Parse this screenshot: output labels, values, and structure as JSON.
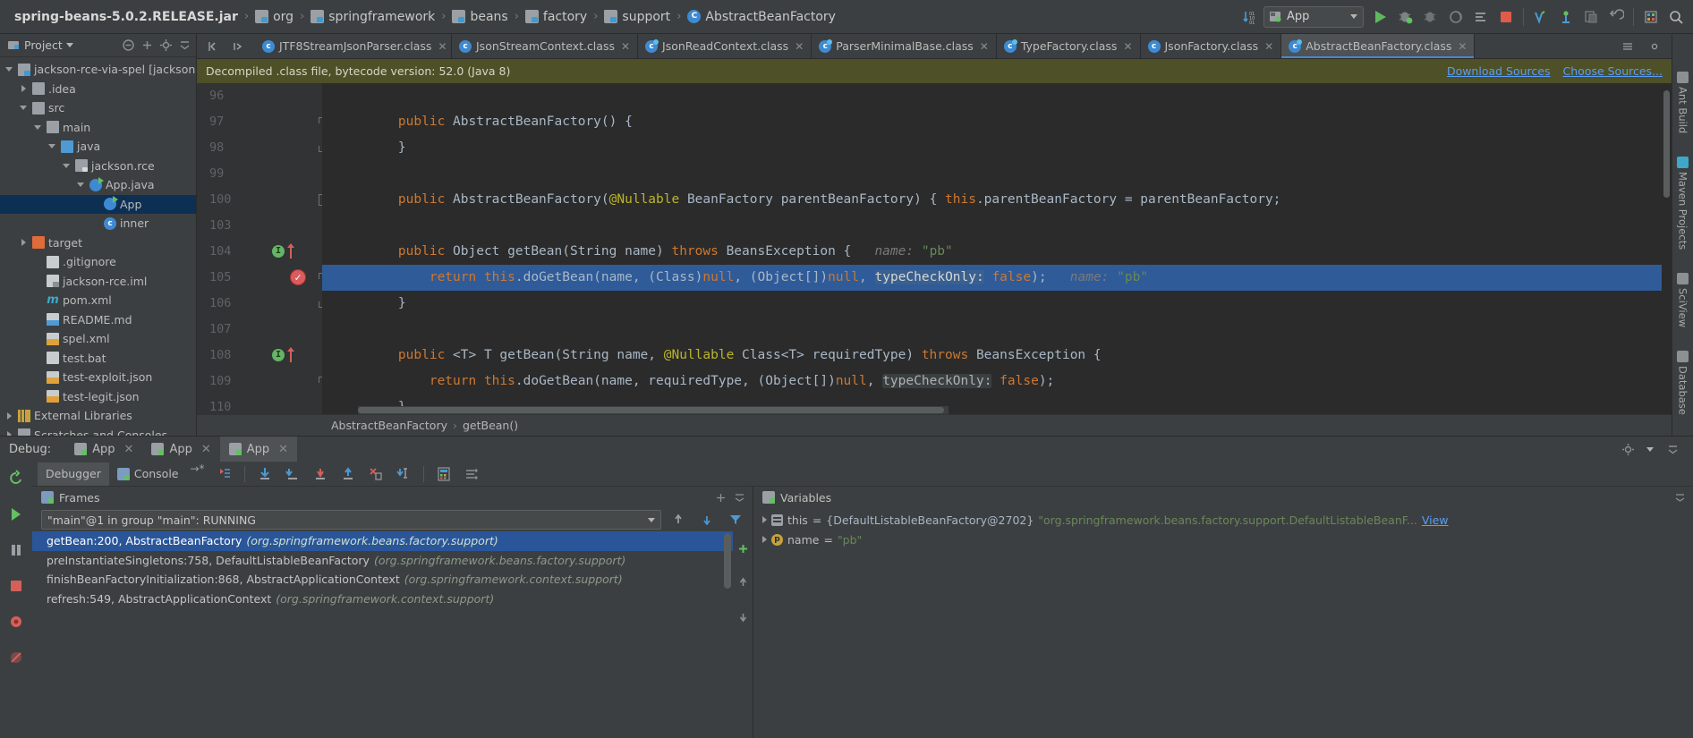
{
  "window": {
    "breadcrumbs": [
      {
        "label": "spring-beans-5.0.2.RELEASE.jar",
        "icon": "jar-icon",
        "root": true
      },
      {
        "label": "org",
        "icon": "folder-icon"
      },
      {
        "label": "springframework",
        "icon": "folder-icon"
      },
      {
        "label": "beans",
        "icon": "folder-icon"
      },
      {
        "label": "factory",
        "icon": "folder-icon"
      },
      {
        "label": "support",
        "icon": "folder-icon"
      },
      {
        "label": "AbstractBeanFactory",
        "icon": "class-icon"
      }
    ],
    "run_config": {
      "label": "App",
      "icon": "run-config-icon"
    },
    "toolbar_icons": [
      "sort-alphabetically-icon",
      "run-icon",
      "debug-icon",
      "coverage-icon",
      "profile-icon",
      "attach-icon",
      "stop-icon",
      "checkin-icon",
      "update-project-icon",
      "compare-icon",
      "revert-icon",
      "settings-icon",
      "search-icon"
    ]
  },
  "project": {
    "title": "Project",
    "header_icons": [
      "collapse-all-icon",
      "expand-icon",
      "settings-icon",
      "hide-icon"
    ],
    "tree": [
      {
        "label": "jackson-rce-via-spel [jackson",
        "indent": 0,
        "twisty": "down",
        "icon": "module-folder",
        "selected": false
      },
      {
        "label": ".idea",
        "indent": 1,
        "twisty": "right",
        "icon": "folder-plain",
        "selected": false
      },
      {
        "label": "src",
        "indent": 1,
        "twisty": "down",
        "icon": "folder-plain",
        "selected": false
      },
      {
        "label": "main",
        "indent": 2,
        "twisty": "down",
        "icon": "folder-plain",
        "selected": false
      },
      {
        "label": "java",
        "indent": 3,
        "twisty": "down",
        "icon": "folder-src",
        "selected": false
      },
      {
        "label": "jackson.rce",
        "indent": 4,
        "twisty": "down",
        "icon": "folder-pkg",
        "selected": false
      },
      {
        "label": "App.java",
        "indent": 5,
        "twisty": "down",
        "icon": "java-main",
        "selected": false
      },
      {
        "label": "App",
        "indent": 6,
        "twisty": "none",
        "icon": "java-main",
        "selected": true
      },
      {
        "label": "inner",
        "indent": 6,
        "twisty": "none",
        "icon": "java-class",
        "selected": false
      },
      {
        "label": "target",
        "indent": 1,
        "twisty": "right",
        "icon": "folder-target",
        "selected": false
      },
      {
        "label": ".gitignore",
        "indent": 2,
        "twisty": "none",
        "icon": "file",
        "selected": false
      },
      {
        "label": "jackson-rce.iml",
        "indent": 2,
        "twisty": "none",
        "icon": "file-module",
        "selected": false
      },
      {
        "label": "pom.xml",
        "indent": 2,
        "twisty": "none",
        "icon": "maven",
        "selected": false
      },
      {
        "label": "README.md",
        "indent": 2,
        "twisty": "none",
        "icon": "file-md",
        "selected": false
      },
      {
        "label": "spel.xml",
        "indent": 2,
        "twisty": "none",
        "icon": "file-xml-spring",
        "selected": false
      },
      {
        "label": "test.bat",
        "indent": 2,
        "twisty": "none",
        "icon": "file",
        "selected": false
      },
      {
        "label": "test-exploit.json",
        "indent": 2,
        "twisty": "none",
        "icon": "file-json",
        "selected": false
      },
      {
        "label": "test-legit.json",
        "indent": 2,
        "twisty": "none",
        "icon": "file-json",
        "selected": false
      },
      {
        "label": "External Libraries",
        "indent": 0,
        "twisty": "right",
        "icon": "library",
        "selected": false
      },
      {
        "label": "Scratches and Consoles",
        "indent": 0,
        "twisty": "right",
        "icon": "scratches",
        "selected": false
      }
    ]
  },
  "editor": {
    "tabs": [
      {
        "label": "JTF8StreamJsonParser.class",
        "active": false,
        "icon": "class-icon"
      },
      {
        "label": "JsonStreamContext.class",
        "active": false,
        "icon": "class-icon"
      },
      {
        "label": "JsonReadContext.class",
        "active": false,
        "icon": "class-icon-deco"
      },
      {
        "label": "ParserMinimalBase.class",
        "active": false,
        "icon": "class-icon-deco"
      },
      {
        "label": "TypeFactory.class",
        "active": false,
        "icon": "class-icon-deco"
      },
      {
        "label": "JsonFactory.class",
        "active": false,
        "icon": "class-icon"
      },
      {
        "label": "AbstractBeanFactory.class",
        "active": true,
        "icon": "class-icon-deco"
      }
    ],
    "notification": {
      "text": "Decompiled .class file, bytecode version: 52.0 (Java 8)",
      "links": [
        "Download Sources",
        "Choose Sources..."
      ]
    },
    "breadcrumb": [
      "AbstractBeanFactory",
      "getBean()"
    ],
    "lines": [
      {
        "num": "96",
        "segments": []
      },
      {
        "num": "97",
        "segments": [
          {
            "t": "    ",
            "c": "txt"
          },
          {
            "t": "public ",
            "c": "kw"
          },
          {
            "t": "AbstractBeanFactory() {",
            "c": "txt"
          }
        ]
      },
      {
        "num": "98",
        "segments": [
          {
            "t": "    }",
            "c": "txt"
          }
        ]
      },
      {
        "num": "99",
        "segments": []
      },
      {
        "num": "100",
        "segments": [
          {
            "t": "    ",
            "c": "txt"
          },
          {
            "t": "public ",
            "c": "kw"
          },
          {
            "t": "AbstractBeanFactory(",
            "c": "txt"
          },
          {
            "t": "@Nullable",
            "c": "annot"
          },
          {
            "t": " BeanFactory parentBeanFactory) { ",
            "c": "txt"
          },
          {
            "t": "this",
            "c": "kw"
          },
          {
            "t": ".parentBeanFactory = parentBeanFactory;",
            "c": "txt"
          }
        ]
      },
      {
        "num": "103",
        "segments": []
      },
      {
        "num": "104",
        "segments": [
          {
            "t": "    ",
            "c": "txt"
          },
          {
            "t": "public ",
            "c": "kw"
          },
          {
            "t": "Object getBean(String name) ",
            "c": "txt"
          },
          {
            "t": "throws ",
            "c": "kw"
          },
          {
            "t": "BeansException {",
            "c": "txt"
          },
          {
            "t": "   name:",
            "c": "hint"
          },
          {
            "t": " \"pb\"",
            "c": "str"
          }
        ],
        "gutter": {
          "green": "I",
          "arrow": true
        }
      },
      {
        "num": "105",
        "highlight": true,
        "breakpoint": "done",
        "segments": [
          {
            "t": "        ",
            "c": "txt"
          },
          {
            "t": "return ",
            "c": "kw"
          },
          {
            "t": "this",
            "c": "kw"
          },
          {
            "t": ".doGetBean(name, (",
            "c": "txt"
          },
          {
            "t": "Class",
            "c": "txt"
          },
          {
            "t": ")",
            "c": "txt"
          },
          {
            "t": "null",
            "c": "kw"
          },
          {
            "t": ", (",
            "c": "txt"
          },
          {
            "t": "Object[]",
            "c": "txt"
          },
          {
            "t": ")",
            "c": "txt"
          },
          {
            "t": "null",
            "c": "kw"
          },
          {
            "t": ", ",
            "c": "txt"
          },
          {
            "t": "typeCheckOnly:",
            "c": "paramhl"
          },
          {
            "t": " ",
            "c": "txt"
          },
          {
            "t": "false",
            "c": "kw"
          },
          {
            "t": ");",
            "c": "txt"
          },
          {
            "t": "   name:",
            "c": "hint"
          },
          {
            "t": " \"pb\"",
            "c": "str"
          }
        ]
      },
      {
        "num": "106",
        "segments": [
          {
            "t": "    }",
            "c": "txt"
          }
        ]
      },
      {
        "num": "107",
        "segments": []
      },
      {
        "num": "108",
        "segments": [
          {
            "t": "    ",
            "c": "txt"
          },
          {
            "t": "public ",
            "c": "kw"
          },
          {
            "t": "<T> T getBean(String name, ",
            "c": "txt"
          },
          {
            "t": "@Nullable",
            "c": "annot"
          },
          {
            "t": " Class<T> requiredType) ",
            "c": "txt"
          },
          {
            "t": "throws ",
            "c": "kw"
          },
          {
            "t": "BeansException {",
            "c": "txt"
          }
        ],
        "gutter": {
          "green": "I",
          "arrow": true
        }
      },
      {
        "num": "109",
        "segments": [
          {
            "t": "        ",
            "c": "txt"
          },
          {
            "t": "return ",
            "c": "kw"
          },
          {
            "t": "this",
            "c": "kw"
          },
          {
            "t": ".doGetBean(name, requiredType, (",
            "c": "txt"
          },
          {
            "t": "Object[]",
            "c": "txt"
          },
          {
            "t": ")",
            "c": "txt"
          },
          {
            "t": "null",
            "c": "kw"
          },
          {
            "t": ", ",
            "c": "txt"
          },
          {
            "t": "typeCheckOnly:",
            "c": "param"
          },
          {
            "t": " ",
            "c": "txt"
          },
          {
            "t": "false",
            "c": "kw"
          },
          {
            "t": ");",
            "c": "txt"
          }
        ]
      },
      {
        "num": "110",
        "segments": [
          {
            "t": "    }",
            "c": "txt"
          }
        ]
      }
    ]
  },
  "right_rail": [
    {
      "label": "Ant Build",
      "icon": "ant-icon"
    },
    {
      "label": "Maven Projects",
      "icon": "maven-icon"
    },
    {
      "label": "SciView",
      "icon": "sciview-icon"
    },
    {
      "label": "Database",
      "icon": "database-icon"
    }
  ],
  "debug": {
    "title": "Debug:",
    "session_tabs": [
      {
        "label": "App",
        "active": false
      },
      {
        "label": "App",
        "active": false
      },
      {
        "label": "App",
        "active": true
      }
    ],
    "subtabs": [
      {
        "label": "Debugger",
        "active": true,
        "icon": "debugger-icon"
      },
      {
        "label": "Console",
        "active": false,
        "icon": "console-icon"
      }
    ],
    "toolbar_icons": [
      "mute-breakpoints-icon",
      "step-over-icon",
      "step-into-icon",
      "force-step-into-icon",
      "step-out-icon",
      "drop-frame-icon",
      "run-to-cursor-icon",
      "evaluate-expression-icon",
      "settings-icon"
    ],
    "left_actions": [
      "rerun-icon",
      "resume-icon",
      "pause-icon",
      "stop-icon",
      "breakpoints-icon",
      "mute-icon"
    ],
    "frames": {
      "title": "Frames",
      "thread": "\"main\"@1 in group \"main\": RUNNING",
      "header_icons": [
        "settings-icon",
        "hide-icon"
      ],
      "toolbar_icons": [
        "up-icon",
        "down-icon",
        "filter-icon",
        "add-icon"
      ],
      "items": [
        {
          "method": "getBean:200, AbstractBeanFactory",
          "package": "(org.springframework.beans.factory.support)",
          "selected": true
        },
        {
          "method": "preInstantiateSingletons:758, DefaultListableBeanFactory",
          "package": "(org.springframework.beans.factory.support)",
          "selected": false
        },
        {
          "method": "finishBeanFactoryInitialization:868, AbstractApplicationContext",
          "package": "(org.springframework.context.support)",
          "selected": false
        },
        {
          "method": "refresh:549, AbstractApplicationContext",
          "package": "(org.springframework.context.support)",
          "selected": false
        }
      ]
    },
    "variables": {
      "title": "Variables",
      "items": [
        {
          "icon": "object-icon",
          "name": "this",
          "eq": " = ",
          "ref": "{DefaultListableBeanFactory@2702}",
          "value": "\"org.springframework.beans.factory.support.DefaultListableBeanF...",
          "link": "View"
        },
        {
          "icon": "param-icon",
          "name": "name",
          "eq": " = ",
          "ref": "",
          "value": "\"pb\"",
          "link": ""
        }
      ]
    }
  }
}
